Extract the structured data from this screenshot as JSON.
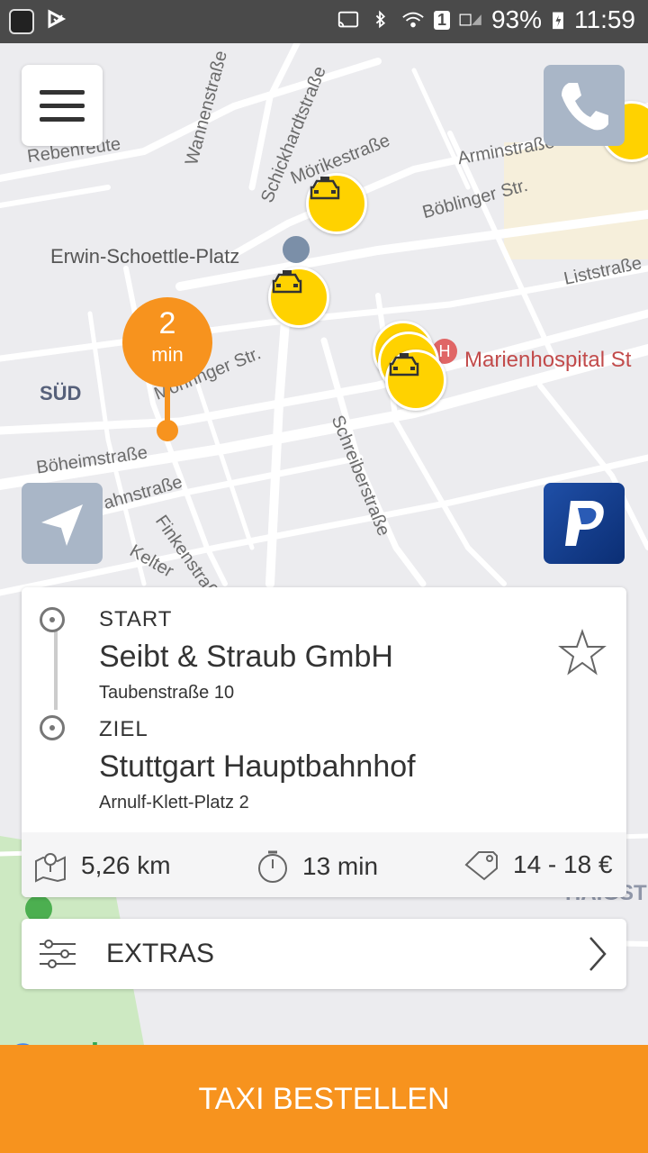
{
  "status_bar": {
    "battery": "93%",
    "time": "11:59",
    "sim_badge": "1"
  },
  "map": {
    "labels": {
      "rebenreute": "Rebenreute",
      "wannenstrasse": "Wannenstraße",
      "schickhardtstrasse": "Schickhardtstraße",
      "moerikestrasse": "Mörikestraße",
      "arminstrasse": "Arminstraße",
      "boeblinger": "Böblinger Str.",
      "erwin_platz": "Erwin-Schoettle-Platz",
      "liststrasse": "Liststraße",
      "sued": "SÜD",
      "moehringer": "Möhringer Str.",
      "marienhospital": "Marienhospital St",
      "boeheimstrasse": "Böheimstraße",
      "bahnstrasse": "ahnstraße",
      "finkenstrasse": "Finkenstraße",
      "schreiberstrasse": "Schreiberstraße",
      "kelter": "Kelter",
      "haigst": "HAIGST",
      "google": "Google"
    },
    "eta_pin": {
      "value": "2",
      "unit": "min"
    }
  },
  "trip": {
    "start": {
      "caption": "START",
      "name": "Seibt & Straub GmbH",
      "address": "Taubenstraße 10"
    },
    "destination": {
      "caption": "ZIEL",
      "name": "Stuttgart Hauptbahnhof",
      "address": "Arnulf-Klett-Platz 2"
    },
    "distance": "5,26 km",
    "duration": "13 min",
    "price": "14 - 18 €"
  },
  "extras_label": "EXTRAS",
  "order_button": "TAXI BESTELLEN",
  "colors": {
    "accent": "#f7931e",
    "taxi": "#ffd200",
    "button_gray": "#a9b6c7"
  }
}
